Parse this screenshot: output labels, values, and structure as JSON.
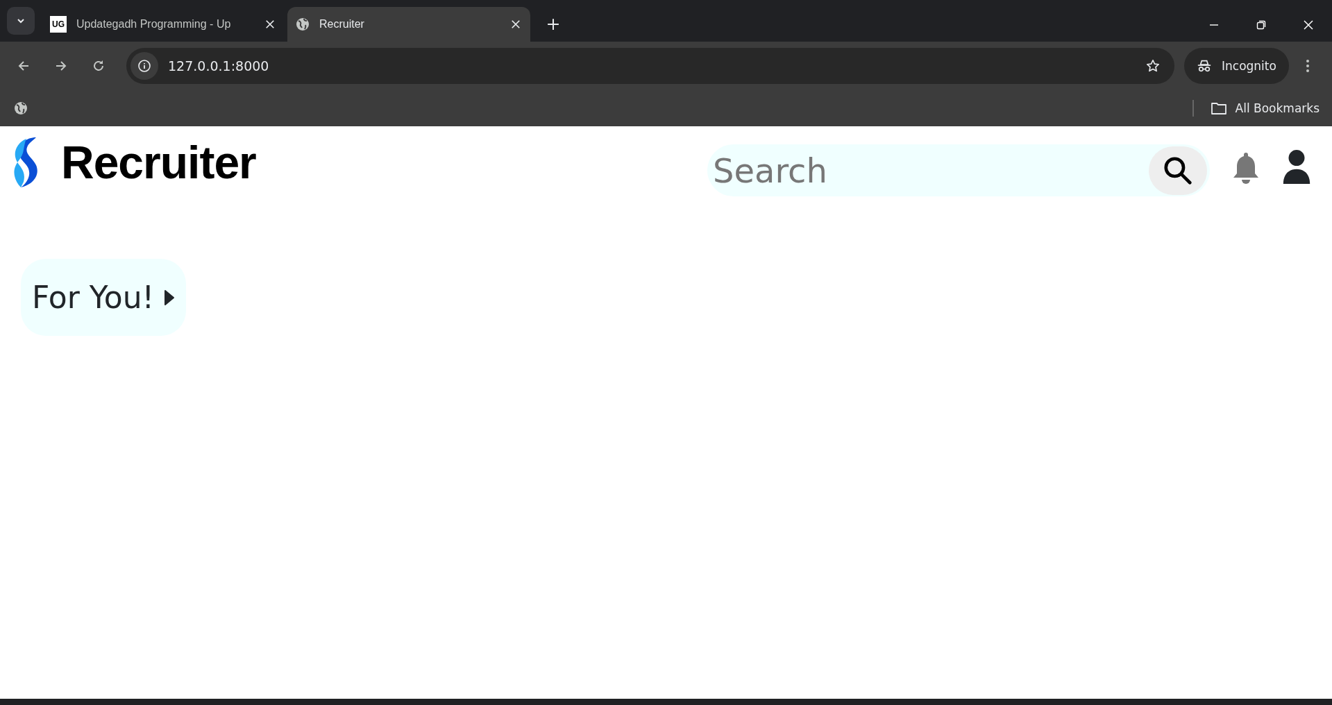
{
  "browser": {
    "tabs": [
      {
        "title": "Updategadh Programming - Up",
        "favicon_text": "UG",
        "selected": false
      },
      {
        "title": "Recruiter",
        "selected": true
      }
    ],
    "address": "127.0.0.1:8000",
    "profile": "Incognito",
    "bookmarks": "All Bookmarks"
  },
  "page": {
    "logo": "Recruiter",
    "search": {
      "placeholder": "Search"
    },
    "for_you_button": "For You!"
  }
}
